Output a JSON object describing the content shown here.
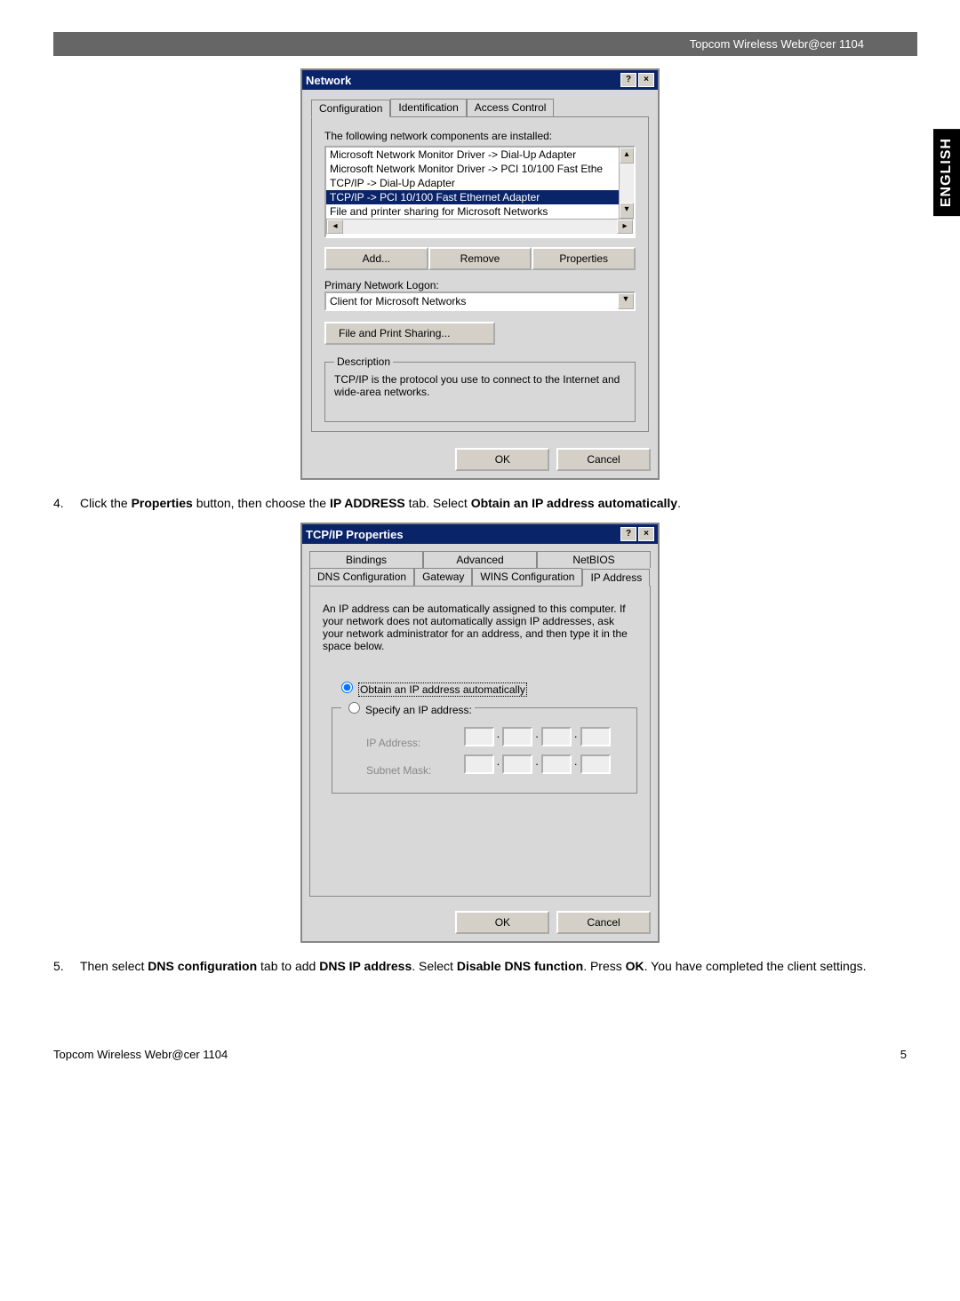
{
  "header_right": "Topcom Wireless Webr@cer 1104",
  "side_tab": "ENGLISH",
  "dialog1": {
    "title": "Network",
    "help_btn": "?",
    "close_btn": "×",
    "tabs": [
      "Configuration",
      "Identification",
      "Access Control"
    ],
    "list_label": "The following network components are installed:",
    "items": [
      "Microsoft Network Monitor Driver -> Dial-Up Adapter",
      "Microsoft Network Monitor Driver -> PCI 10/100 Fast Ethe",
      "TCP/IP -> Dial-Up Adapter",
      "TCP/IP -> PCI 10/100 Fast Ethernet Adapter",
      "File and printer sharing for Microsoft Networks"
    ],
    "selected_index": 3,
    "add_btn": "Add...",
    "remove_btn": "Remove",
    "properties_btn": "Properties",
    "primary_logon_label": "Primary Network Logon:",
    "primary_logon_value": "Client for Microsoft Networks",
    "file_print_btn": "File and Print Sharing...",
    "desc_legend": "Description",
    "desc_text": "TCP/IP is the protocol you use to connect to the Internet and wide-area networks.",
    "ok_btn": "OK",
    "cancel_btn": "Cancel"
  },
  "step4_num": "4.",
  "step4_text_parts": [
    "Click the ",
    "Properties",
    " button, then choose the ",
    "IP ADDRESS",
    " tab. Select ",
    "Obtain an IP address automatically",
    "."
  ],
  "dialog2": {
    "title": "TCP/IP Properties",
    "help_btn": "?",
    "close_btn": "×",
    "tabs_row1": [
      "Bindings",
      "Advanced",
      "NetBIOS"
    ],
    "tabs_row2": [
      "DNS Configuration",
      "Gateway",
      "WINS Configuration",
      "IP Address"
    ],
    "active_tab": "IP Address",
    "explain": "An IP address can be automatically assigned to this computer. If your network does not automatically assign IP addresses, ask your network administrator for an address, and then type it in the space below.",
    "radio_auto": "Obtain an IP address automatically",
    "radio_specify": "Specify an IP address:",
    "ip_label": "IP Address:",
    "subnet_label": "Subnet Mask:",
    "ok_btn": "OK",
    "cancel_btn": "Cancel"
  },
  "step5_num": "5.",
  "step5_text_parts": [
    "Then select ",
    "DNS configuration",
    " tab to add ",
    "DNS IP address",
    ". Select ",
    "Disable DNS function",
    ". Press ",
    "OK",
    ". You have completed the client settings."
  ],
  "footer_left": "Topcom Wireless Webr@cer 1104",
  "footer_right": "5"
}
